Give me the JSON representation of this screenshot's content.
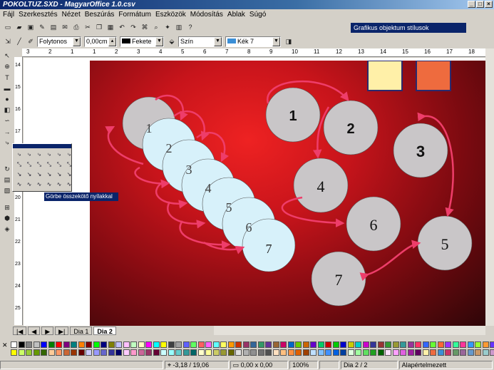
{
  "window": {
    "title": "POKOLTUZ.SXD - MagyarOffice 1.0.csv"
  },
  "menu": [
    "Fájl",
    "Szerkesztés",
    "Nézet",
    "Beszúrás",
    "Formátum",
    "Eszközök",
    "Módosítás",
    "Ablak",
    "Súgó"
  ],
  "linebar": {
    "line_style": "Folytonos",
    "line_width": "0,00cm",
    "line_color": "Fekete",
    "area_mode": "Szín",
    "area_color": "Kék 7"
  },
  "style_panel": {
    "title": "Grafikus objektum stílusok"
  },
  "ruler_h": [
    "3",
    "2",
    "1",
    "1",
    "2",
    "3",
    "4",
    "5",
    "6",
    "7",
    "8",
    "9",
    "10",
    "11",
    "12",
    "13",
    "14",
    "15",
    "16",
    "17",
    "18"
  ],
  "ruler_v": [
    "14",
    "15",
    "16",
    "17",
    "18",
    "19",
    "20",
    "21",
    "22",
    "23",
    "24",
    "25"
  ],
  "slide": {
    "left_stack": [
      "1",
      "2",
      "3",
      "4",
      "5",
      "6",
      "7"
    ],
    "right_nodes": [
      "1",
      "2",
      "3",
      "4",
      "5",
      "6",
      "7"
    ]
  },
  "tooltip": "Görbe összekötő nyílakkal",
  "tabs": [
    "Dia 1",
    "Dia 2"
  ],
  "status": {
    "position": "-3,18 / 19,06",
    "size": "0,00 x 0,00",
    "zoom": "100%",
    "page": "Dia 2 / 2",
    "style": "Alapértelmezett"
  },
  "colors": {
    "accent": "#0a246a",
    "arrow": "#ee3d6a",
    "circle_fill": "#c9c6c8",
    "circle_fill_light": "#d7f1fa",
    "swatch_yellow": "#fff0a8",
    "swatch_orange": "#ee6b3e"
  }
}
